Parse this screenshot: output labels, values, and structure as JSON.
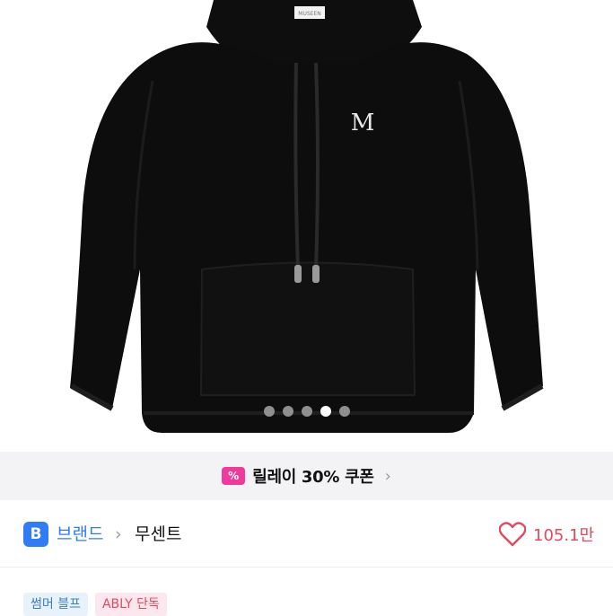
{
  "product_image": {
    "logo_letter": "M",
    "neck_label": "MUSEEN",
    "carousel": {
      "count": 5,
      "active_index": 3
    }
  },
  "coupon": {
    "label": "릴레이 30% 쿠폰",
    "icon": "percent-ticket-icon",
    "chevron": "›"
  },
  "brand": {
    "badge": "B",
    "link_label": "브랜드",
    "separator": "›",
    "name": "무센트"
  },
  "like": {
    "icon": "heart-outline-icon",
    "count": "105.1만"
  },
  "tags": [
    {
      "label": "썸머 블프"
    },
    {
      "label": "ABLY 단독"
    }
  ],
  "colors": {
    "brand_blue": "#2f7cf6",
    "coupon_pink": "#f0399a",
    "like_red": "#e2495f",
    "hoodie_black": "#0d0d0d"
  }
}
